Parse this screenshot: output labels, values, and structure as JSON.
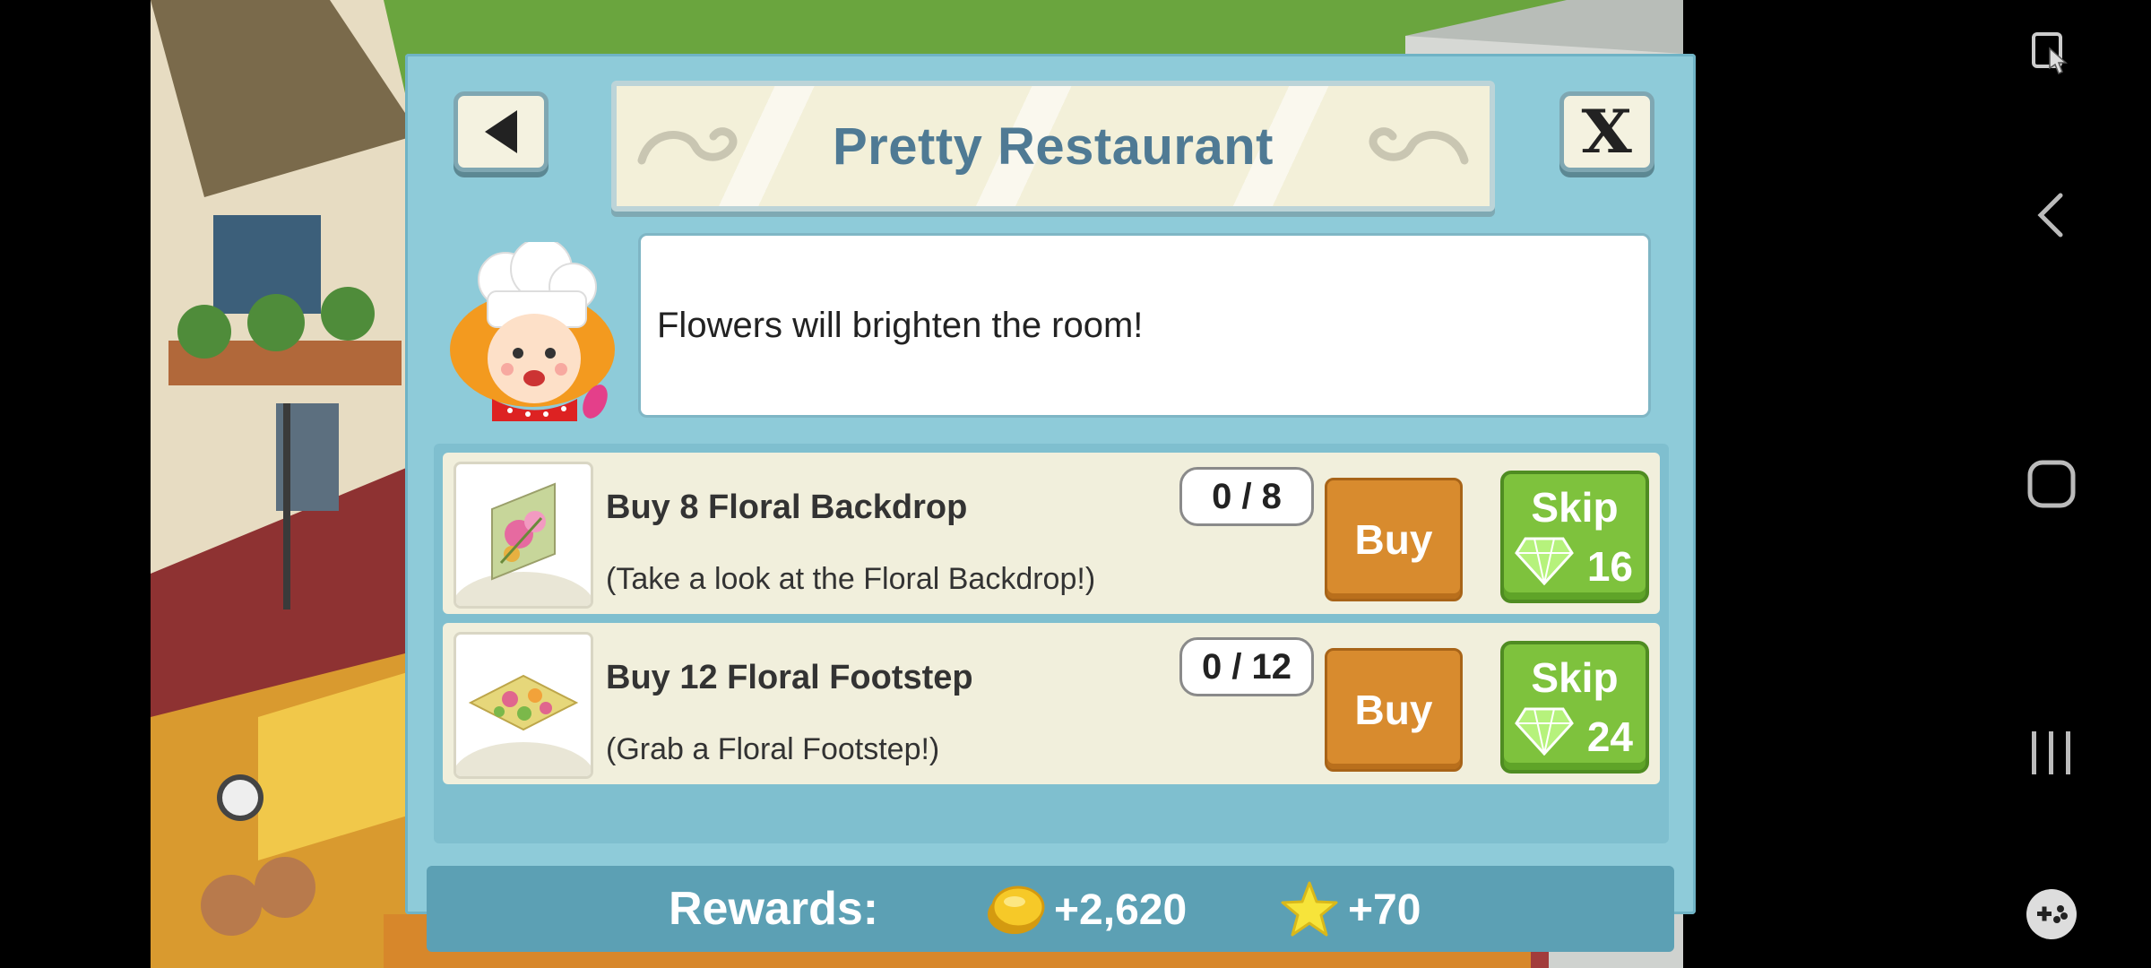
{
  "dialog": {
    "title": "Pretty Restaurant",
    "message": "Flowers will brighten the room!"
  },
  "tasks": [
    {
      "title": "Buy 8 Floral Backdrop",
      "description": "(Take a look at the Floral Backdrop!)",
      "progress": "0 / 8",
      "buy_label": "Buy",
      "skip_label": "Skip",
      "skip_cost": "16",
      "icon": "floral-backdrop-icon"
    },
    {
      "title": "Buy 12 Floral Footstep",
      "description": "(Grab a Floral Footstep!)",
      "progress": "0 / 12",
      "buy_label": "Buy",
      "skip_label": "Skip",
      "skip_cost": "24",
      "icon": "floral-footstep-icon"
    }
  ],
  "rewards": {
    "label": "Rewards:",
    "coins": "+2,620",
    "stars": "+70"
  },
  "colors": {
    "dialog_bg": "#8ecbd9",
    "title_text": "#4f7a94",
    "buy_button": "#d88b2e",
    "skip_button": "#7ec23d",
    "rewards_bar": "#5ca0b4"
  },
  "nav_icons": [
    "screen-assist-icon",
    "back-icon",
    "home-icon",
    "recents-icon",
    "game-tools-icon"
  ]
}
